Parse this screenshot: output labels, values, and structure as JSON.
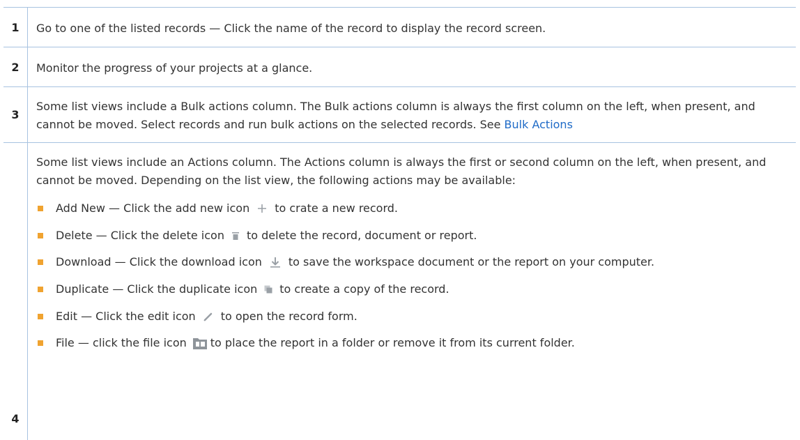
{
  "rows": [
    {
      "num": "1",
      "text": "Go to one of the listed records — Click the name of the record to display the record screen."
    },
    {
      "num": "2",
      "text": "Monitor the progress of your projects at a glance."
    },
    {
      "num": "3",
      "text": "Some list views include a Bulk actions column. The Bulk actions column is always the first column on the left, when present, and cannot be moved. Select records and run bulk actions on the selected records. See ",
      "link": "Bulk Actions"
    },
    {
      "num": "4",
      "intro": "Some list views include an Actions column. The Actions column is always the first or second column on the left, when present, and cannot be moved. Depending on the list view, the following actions may be available:",
      "actions": [
        {
          "label": "Add New",
          "pre": "Click the add new icon",
          "post": "to crate a new record.",
          "icon": "plus-icon"
        },
        {
          "label": "Delete",
          "pre": "Click the delete icon",
          "post": "to delete the record, document or report.",
          "icon": "trash-icon"
        },
        {
          "label": "Download",
          "pre": "Click the download icon",
          "post": "to save the workspace document or the report on your computer.",
          "icon": "download-icon"
        },
        {
          "label": "Duplicate",
          "pre": "Click the duplicate icon",
          "post": "to create a copy of the record.",
          "icon": "duplicate-icon"
        },
        {
          "label": "Edit",
          "pre": "Click the edit icon",
          "post": "to open the record form.",
          "icon": "pencil-icon"
        },
        {
          "label": "File",
          "pre": "click the file icon",
          "post": "to place the report in a folder or remove it from its current folder.",
          "icon": "file-folder-icon"
        }
      ]
    }
  ],
  "colors": {
    "border": "#a7c3e0",
    "bullet": "#f0a330",
    "link": "#1f6bc7",
    "icon": "#9aa0a6"
  }
}
